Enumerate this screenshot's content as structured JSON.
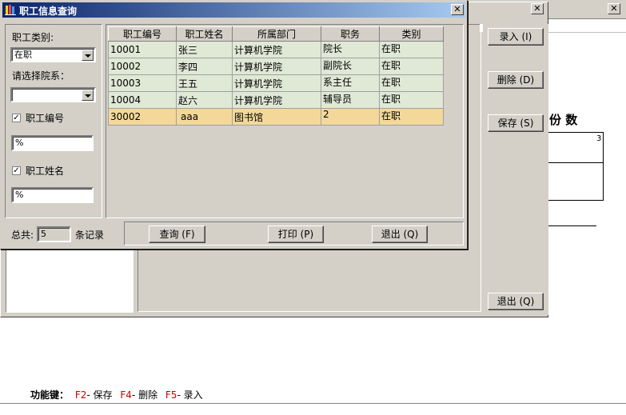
{
  "main_window": {
    "buttons": {
      "record": "录入 (I)",
      "delete": "删除 (D)",
      "save": "保存 (S)",
      "exit": "退出 (Q)"
    },
    "partial_header": "份 数",
    "partial_value": "3",
    "footer": {
      "label": "功能键：",
      "f2_key": "F2",
      "f2_text": "- 保存",
      "f4_key": "F4",
      "f4_text": "- 删除",
      "f5_key": "F5",
      "f5_text": "- 录入"
    }
  },
  "dialog": {
    "title": "职工信息查询",
    "filters": {
      "category_label": "职工类别:",
      "category_value": "在职",
      "department_label": "请选择院系：",
      "department_value": "",
      "staff_id_label": "职工编号",
      "staff_id_checked": true,
      "staff_id_value": "%",
      "staff_name_label": "职工姓名",
      "staff_name_checked": true,
      "staff_name_value": "%"
    },
    "table": {
      "columns": [
        "职工编号",
        "职工姓名",
        "所属部门",
        "职务",
        "类别"
      ],
      "rows": [
        [
          "10001",
          "张三",
          "计算机学院",
          "院长",
          "在职"
        ],
        [
          "10002",
          "李四",
          "计算机学院",
          "副院长",
          "在职"
        ],
        [
          "10003",
          "王五",
          "计算机学院",
          "系主任",
          "在职"
        ],
        [
          "10004",
          "赵六",
          "计算机学院",
          "辅导员",
          "在职"
        ],
        [
          "30002",
          "aaa",
          "图书馆",
          "2",
          "在职"
        ]
      ],
      "selected_row": 4
    },
    "total_label": "总共:",
    "total_value": "5",
    "total_unit": "条记录",
    "buttons": {
      "query": "查询 (F)",
      "print": "打印 (P)",
      "exit": "退出 (Q)"
    },
    "colors": {
      "title_bar": "#0a246a",
      "row_bg": "#e0e8d6",
      "selected_row_bg": "#f3d89a"
    }
  }
}
